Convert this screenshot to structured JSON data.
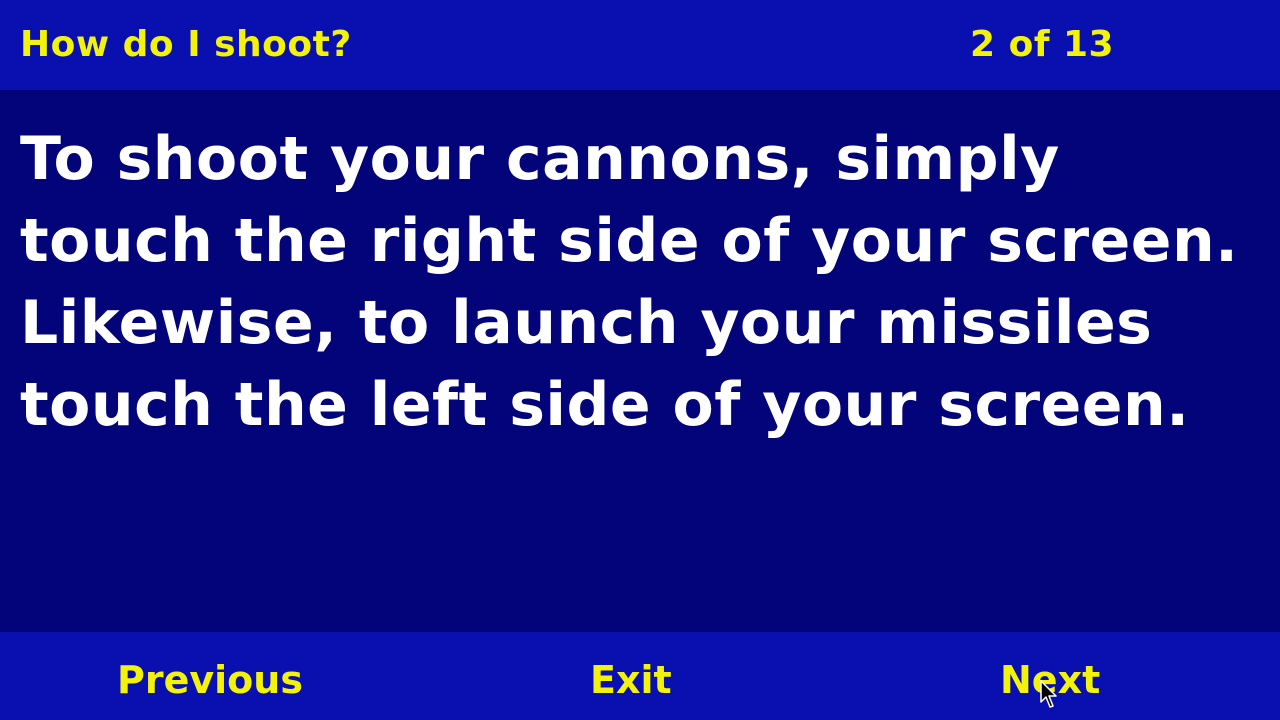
{
  "header": {
    "title": "How do I shoot?",
    "page_counter": "2 of 13"
  },
  "content": {
    "text": "To shoot your cannons, simply touch the right side of your screen.  Likewise, to launch your missiles touch the left side of your screen."
  },
  "footer": {
    "previous_label": "Previous",
    "exit_label": "Exit",
    "next_label": "Next"
  },
  "colors": {
    "background": "#03037a",
    "bar": "#0a10b0",
    "accent_yellow": "#f2f20a",
    "text_white": "#ffffff"
  },
  "icons": {
    "cursor": "mouse-pointer-icon"
  }
}
